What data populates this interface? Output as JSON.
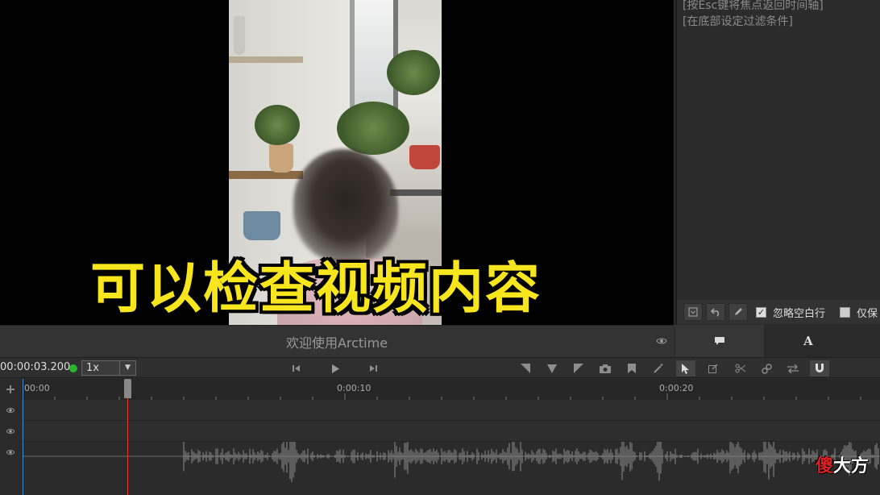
{
  "video": {
    "subtitle": "可以检查视频内容"
  },
  "right_panel": {
    "hints": [
      "[按Esc键将焦点返回时间轴]",
      "[在底部设定过滤条件]"
    ],
    "filters": {
      "ignore_empty_label": "忽略空白行",
      "ignore_empty_checked": true,
      "keep_only_label": "仅保",
      "keep_only_checked": false
    },
    "tabs": [
      {
        "icon": "speech-bubble-icon",
        "label": "💬"
      },
      {
        "icon": "font-icon",
        "label": "A"
      }
    ]
  },
  "title_bar": {
    "title": "欢迎使用Arctime"
  },
  "transport": {
    "timecode": "00:00:03.200",
    "speed": "1x"
  },
  "timeline": {
    "tick_labels": [
      "00:00",
      "0:00:10",
      "0:00:20"
    ]
  },
  "watermark": {
    "brand_red": "傻",
    "brand_rest": "大方"
  },
  "colors": {
    "subtitle": "#f7e51e",
    "status_dot": "#2bb52b",
    "cursor": "#e03a2a"
  }
}
